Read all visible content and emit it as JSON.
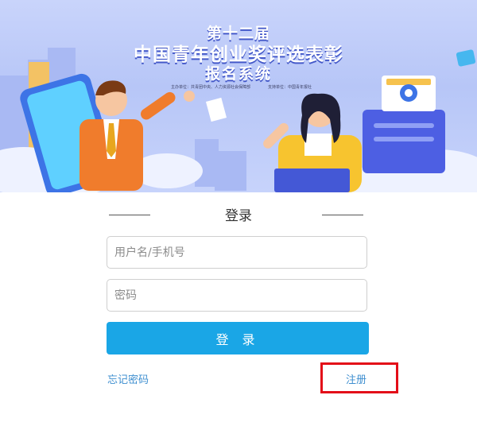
{
  "banner": {
    "edition": "第十二届",
    "event_title": "中国青年创业奖评选表彰",
    "system_name": "报名系统",
    "organizer": "主办单位：共青团中央、人力资源社会保障部",
    "supporter": "支持单位：中国青年报社"
  },
  "login": {
    "title": "登录",
    "username_placeholder": "用户名/手机号",
    "password_placeholder": "密码",
    "submit_label": "登 录",
    "forgot_password": "忘记密码",
    "register": "注册"
  },
  "colors": {
    "primary_button": "#1aa6e6",
    "link": "#3f8fd0",
    "highlight_box": "#e30d18"
  }
}
